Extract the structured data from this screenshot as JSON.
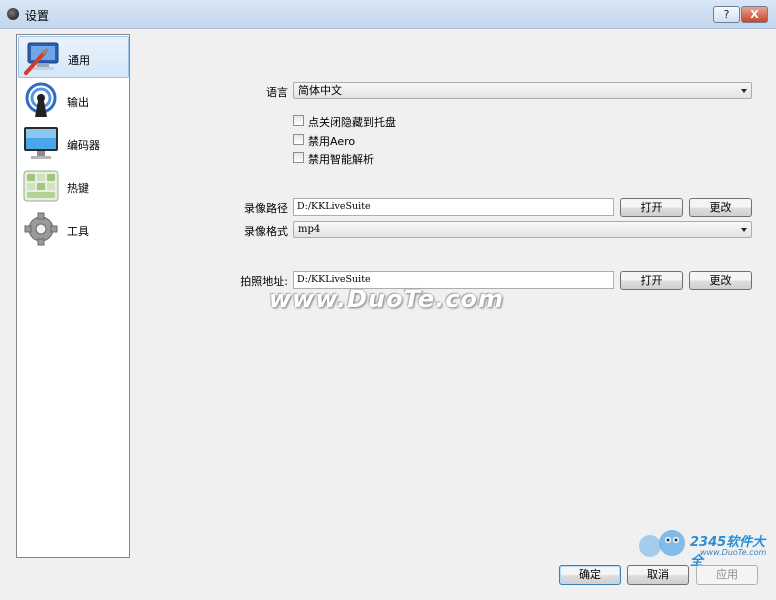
{
  "window": {
    "title": "设置",
    "help_label": "?",
    "close_label": "X"
  },
  "sidebar": {
    "items": [
      {
        "label": "通用",
        "icon": "monitor-tools-icon",
        "active": true
      },
      {
        "label": "输出",
        "icon": "broadcast-icon",
        "active": false
      },
      {
        "label": "编码器",
        "icon": "display-icon",
        "active": false
      },
      {
        "label": "热键",
        "icon": "keyboard-icon",
        "active": false
      },
      {
        "label": "工具",
        "icon": "gear-icon",
        "active": false
      }
    ]
  },
  "general": {
    "language_label": "语言",
    "language_value": "简体中文",
    "checkboxes": [
      {
        "label": "点关闭隐藏到托盘",
        "checked": false
      },
      {
        "label": "禁用Aero",
        "checked": false
      },
      {
        "label": "禁用智能解析",
        "checked": false
      }
    ],
    "record_path_label": "录像路径",
    "record_path_value": "D:/KKLiveSuite",
    "record_path_open": "打开",
    "record_path_change": "更改",
    "record_format_label": "录像格式",
    "record_format_value": "mp4",
    "photo_path_label": "拍照地址:",
    "photo_path_value": "D:/KKLiveSuite",
    "photo_path_open": "打开",
    "photo_path_change": "更改"
  },
  "watermark": {
    "text": "www.DuoTe.com"
  },
  "corner_logo": {
    "brand": "2345软件大全",
    "url": "www.DuoTe.com"
  },
  "footer": {
    "ok_label": "确定",
    "cancel_label": "取消",
    "apply_label": "应用"
  }
}
